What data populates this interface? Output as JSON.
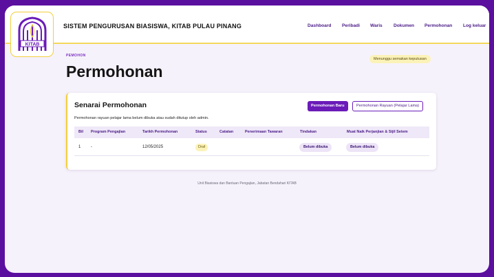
{
  "header": {
    "logo_text": "KITAB",
    "site_title": "SISTEM PENGURUSAN BIASISWA, KITAB PULAU PINANG",
    "nav": [
      "Dashboard",
      "Peribadi",
      "Waris",
      "Dokumen",
      "Permohonan",
      "Log keluar"
    ]
  },
  "page": {
    "breadcrumb": "PEMOHON",
    "title": "Permohonan",
    "status_pill": "Menunggu semakan keputusan"
  },
  "card": {
    "title": "Senarai Permohonan",
    "new_button": "Permohonan Baru",
    "appeal_button": "Permohonan Rayuan (Pelajar Lama)",
    "note": "Permohonan rayuan pelajar lama belum dibuka atau sudah ditutup oleh admin.",
    "columns": [
      "Bil",
      "Program Pengajian",
      "Tarikh Permohonan",
      "Status",
      "Catatan",
      "Penerimaan Tawaran",
      "Tindakan",
      "Muat Naik Perjanjian & Sijil Setem"
    ],
    "rows": [
      {
        "bil": "1",
        "program": "-",
        "tarikh": "12/05/2025",
        "status": "Draf",
        "catatan": "",
        "penerimaan": "",
        "tindakan": "Belum dibuka",
        "muat_naik": "Belum dibuka"
      }
    ]
  },
  "footer": "Unit Biasiswa dan Bantuan Pengajian, Jabatan Bendahari KITAB",
  "colors": {
    "brand_purple": "#5b0f9e",
    "button_purple": "#6a1bb8",
    "accent_yellow": "#f2cf3a",
    "page_background": "#f6f2fb"
  }
}
